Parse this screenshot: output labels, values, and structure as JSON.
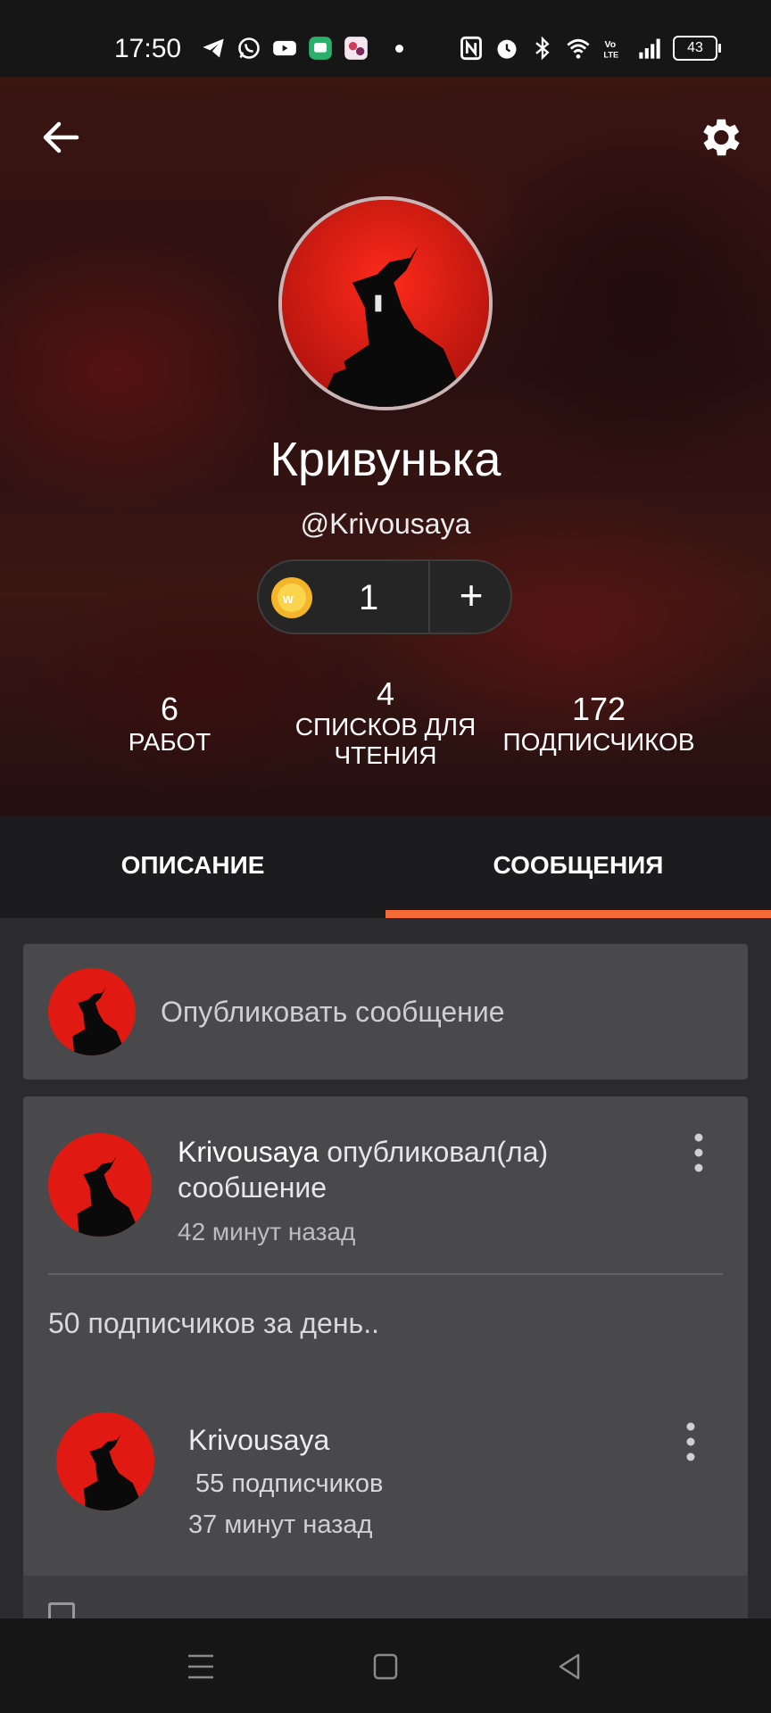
{
  "status_bar": {
    "time": "17:50",
    "left_icons": [
      "telegram-icon",
      "whatsapp-icon",
      "youtube-icon",
      "messenger-app-icon",
      "app-icon"
    ],
    "right_icons": [
      "nfc-icon",
      "alarm-icon",
      "bluetooth-icon",
      "wifi-icon",
      "volte-icon",
      "signal-icon"
    ],
    "battery": "43"
  },
  "header": {
    "back_icon": "arrow-left-icon",
    "settings_icon": "gear-icon",
    "display_name": "Кривунька",
    "username": "@Krivousaya",
    "coins": "1",
    "coin_add": "+"
  },
  "stats": [
    {
      "value": "6",
      "label": "РАБОТ"
    },
    {
      "value": "4",
      "label": "СПИСКОВ ДЛЯ ЧТЕНИЯ"
    },
    {
      "value": "172",
      "label": "ПОДПИСЧИКОВ"
    }
  ],
  "tabs": {
    "description": "ОПИСАНИЕ",
    "messages": "СООБЩЕНИЯ",
    "active": "messages"
  },
  "compose": {
    "placeholder": "Опубликовать сообщение"
  },
  "post": {
    "author": "Krivousaya",
    "action": "опубликовал(ла) сообшение",
    "time": "42 минут назад",
    "body": "50 подписчиков за день..",
    "embed": {
      "name": "Krivousaya",
      "followers": "55 подписчиков",
      "time": "37 минут назад"
    }
  },
  "colors": {
    "accent": "#f36b35",
    "card": "#49494b",
    "background": "#2b2b2d",
    "coin": "#f4b52a"
  }
}
